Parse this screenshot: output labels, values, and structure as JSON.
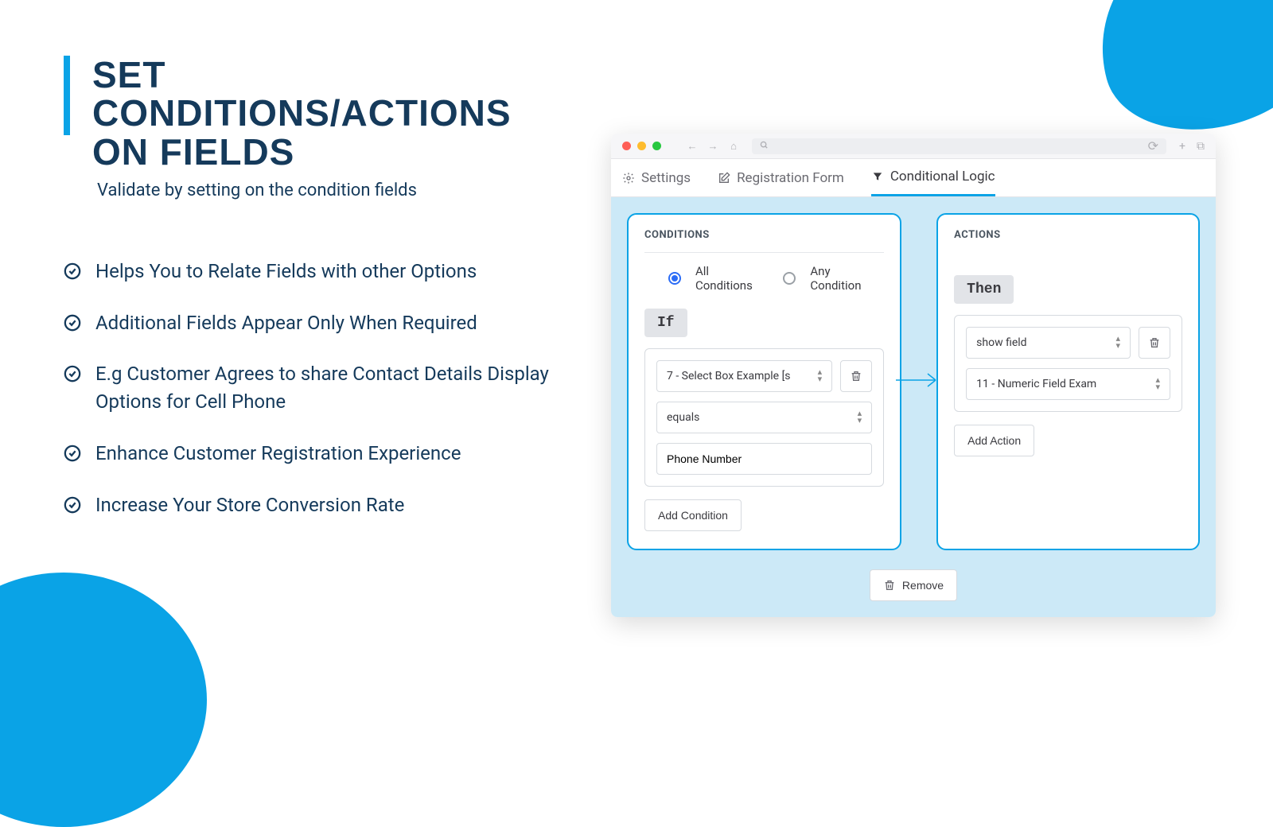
{
  "hero": {
    "title": "SET CONDITIONS/ACTIONS ON FIELDS",
    "subtitle": "Validate by setting on the condition fields",
    "bullets": [
      "Helps You to Relate Fields with other Options",
      "Additional Fields Appear Only When Required",
      "E.g Customer Agrees to share Contact Details Display Options for Cell Phone",
      "Enhance Customer Registration Experience",
      "Increase Your Store Conversion Rate"
    ]
  },
  "tabs": {
    "settings": "Settings",
    "registration": "Registration Form",
    "conditional": "Conditional Logic"
  },
  "conditions": {
    "title": "CONDITIONS",
    "radio_all": "All Conditions",
    "radio_any": "Any Condition",
    "if_label": "If",
    "field_select": "7 - Select Box Example [s",
    "operator": "equals",
    "value": "Phone Number",
    "add_btn": "Add Condition"
  },
  "actions": {
    "title": "ACTIONS",
    "then_label": "Then",
    "action_select": "show field",
    "target_select": "11 - Numeric Field Exam",
    "add_btn": "Add Action"
  },
  "remove_btn": "Remove"
}
